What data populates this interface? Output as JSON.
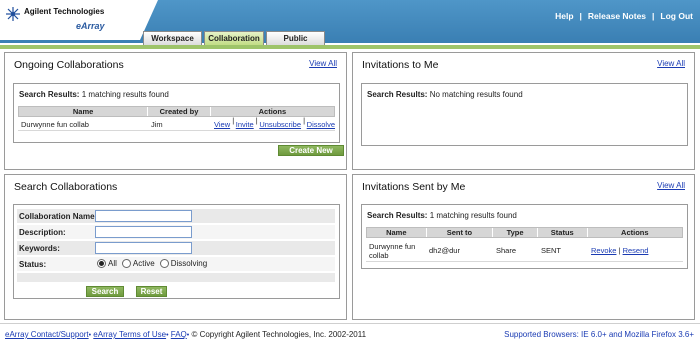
{
  "brand": {
    "company": "Agilent Technologies",
    "product": "eArray"
  },
  "header_links": [
    "Help",
    "Release Notes",
    "Log Out"
  ],
  "tabs": [
    {
      "label": "Workspace",
      "active": false
    },
    {
      "label": "Collaboration",
      "active": true
    },
    {
      "label": "Public",
      "active": false
    }
  ],
  "ongoing": {
    "title": "Ongoing Collaborations",
    "view_all": "View All",
    "results_label": "Search Results:",
    "results_text": "1 matching results found",
    "columns": [
      "Name",
      "Created by",
      "Actions"
    ],
    "rows": [
      {
        "name": "Durwynne fun collab",
        "created_by": "Jim",
        "actions": [
          "View",
          "Invite",
          "Unsubscribe",
          "Dissolve"
        ]
      }
    ],
    "create_button": "Create New"
  },
  "invitations_to_me": {
    "title": "Invitations to Me",
    "view_all": "View All",
    "results_label": "Search Results:",
    "results_text": "No matching results found"
  },
  "search": {
    "title": "Search Collaborations",
    "fields": [
      {
        "label": "Collaboration Name:",
        "value": ""
      },
      {
        "label": "Description:",
        "value": ""
      },
      {
        "label": "Keywords:",
        "value": ""
      }
    ],
    "status_label": "Status:",
    "status_options": [
      {
        "label": "All",
        "selected": true
      },
      {
        "label": "Active",
        "selected": false
      },
      {
        "label": "Dissolving",
        "selected": false
      }
    ],
    "search_button": "Search",
    "reset_button": "Reset"
  },
  "invitations_sent": {
    "title": "Invitations Sent by Me",
    "view_all": "View All",
    "results_label": "Search Results:",
    "results_text": "1 matching results found",
    "columns": [
      "Name",
      "Sent to",
      "Type",
      "Status",
      "Actions"
    ],
    "rows": [
      {
        "name_line1": "Durwynne fun",
        "name_line2": "collab",
        "sent_to": "dh2@dur",
        "type": "Share",
        "status": "SENT",
        "actions": [
          "Revoke",
          "Resend"
        ]
      }
    ]
  },
  "footer": {
    "links": [
      "eArray Contact/Support",
      "eArray Terms of Use",
      "FAQ"
    ],
    "copyright": "© Copyright Agilent Technologies, Inc. 2002-2011",
    "browsers": "Supported Browsers: IE 6.0+ and Mozilla Firefox 3.6+"
  },
  "colors": {
    "header_blue": "#4589bd",
    "accent_green": "#7ca84b",
    "link_blue": "#1a3bb3"
  }
}
